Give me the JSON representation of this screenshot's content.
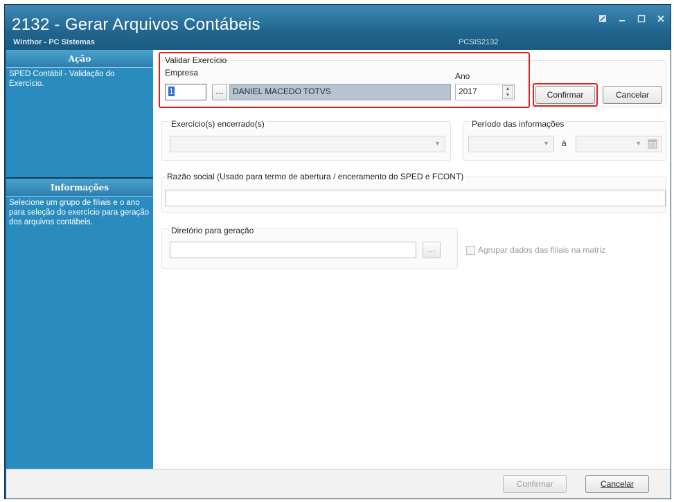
{
  "window": {
    "title": "2132 - Gerar Arquivos Contábeis",
    "subtitle": "Winthor - PC Sistemas",
    "code": "PCSIS2132"
  },
  "sidebar": {
    "acao_header": "Ação",
    "acao_text": "SPED Contábil - Validação do Exercício.",
    "info_header": "Informações",
    "info_text": "Selecione um grupo de filiais e o ano para seleção do exercício para geração dos arquivos contábeis."
  },
  "validar": {
    "group_label": "Validar Exercício",
    "empresa_label": "Empresa",
    "empresa_code": "1",
    "ellipsis": "...",
    "empresa_name": "DANIEL MACEDO TOTVS",
    "ano_label": "Ano",
    "ano_value": "2017",
    "confirm_label": "Confirmar",
    "cancel_label": "Cancelar"
  },
  "exercicio": {
    "label": "Exercício(s) encerrado(s)"
  },
  "periodo": {
    "label": "Período das informações",
    "sep": "à"
  },
  "razao": {
    "label": "Razão social (Usado para termo de abertura / enceramento do SPED e FCONT)"
  },
  "diretorio": {
    "label": "Diretório para geração",
    "ellipsis": "...",
    "agrupar_label": "Agrupar dados das filiais na matriz"
  },
  "footer": {
    "confirm_label": "Confirmar",
    "cancel_label": "Cancelar"
  },
  "colors": {
    "titlebar": "#21668f",
    "sidebar": "#2a8bbf",
    "highlight": "#e02020"
  }
}
